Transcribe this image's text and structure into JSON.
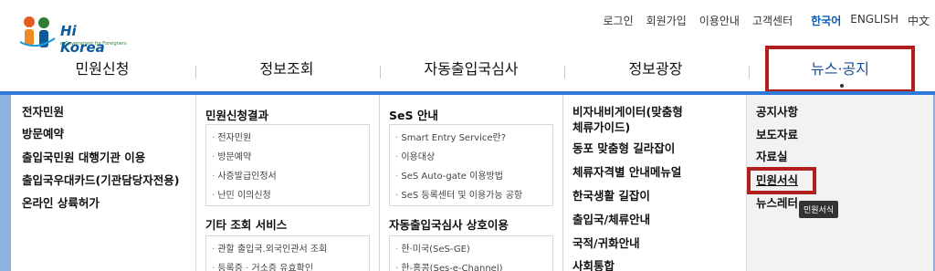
{
  "logo": {
    "brand": "Hi Korea",
    "tagline": "e-Government for Foreigners"
  },
  "util_nav": [
    "로그인",
    "회원가입",
    "이용안내",
    "고객센터"
  ],
  "languages": [
    {
      "label": "한국어",
      "active": true
    },
    {
      "label": "ENGLISH",
      "active": false
    },
    {
      "label": "中文",
      "active": false
    }
  ],
  "gnb": [
    "민원신청",
    "정보조회",
    "자동출입국심사",
    "정보광장",
    "뉴스·공지"
  ],
  "col1": [
    "전자민원",
    "방문예약",
    "출입국민원 대행기관 이용",
    "출입국우대카드(기관담당자전용)",
    "온라인 상륙허가"
  ],
  "col2": {
    "section1_title": "민원신청결과",
    "section1_items": [
      "전자민원",
      "방문예약",
      "사증발급인정서",
      "난민 이의신청"
    ],
    "section2_title": "기타 조회 서비스",
    "section2_items": [
      "관할 출입국.외국인관서 조회",
      "등록증 · 거소증 유효확인"
    ]
  },
  "col3": {
    "section1_title": "SeS 안내",
    "section1_items": [
      "Smart Entry Service란?",
      "이용대상",
      "SeS Auto-gate 이용방법",
      "SeS 등록센터 및 이용가능 공항"
    ],
    "section2_title": "자동출입국심사 상호이용",
    "section2_items": [
      "한·미국(SeS-GE)",
      "한-홍콩(Ses-e-Channel)"
    ]
  },
  "col4": [
    "비자내비게이터(맞춤형",
    "체류가이드)",
    "동포 맞춤형 길라잡이",
    "체류자격별 안내메뉴얼",
    "한국생활 길잡이",
    "출입국/체류안내",
    "국적/귀화안내",
    "사회통합"
  ],
  "col5": [
    "공지사항",
    "보도자료",
    "자료실",
    "민원서식",
    "뉴스레터"
  ],
  "tooltip": "민원서식",
  "colors": {
    "accent": "#2f7ad8",
    "highlight": "#b01e1e"
  }
}
